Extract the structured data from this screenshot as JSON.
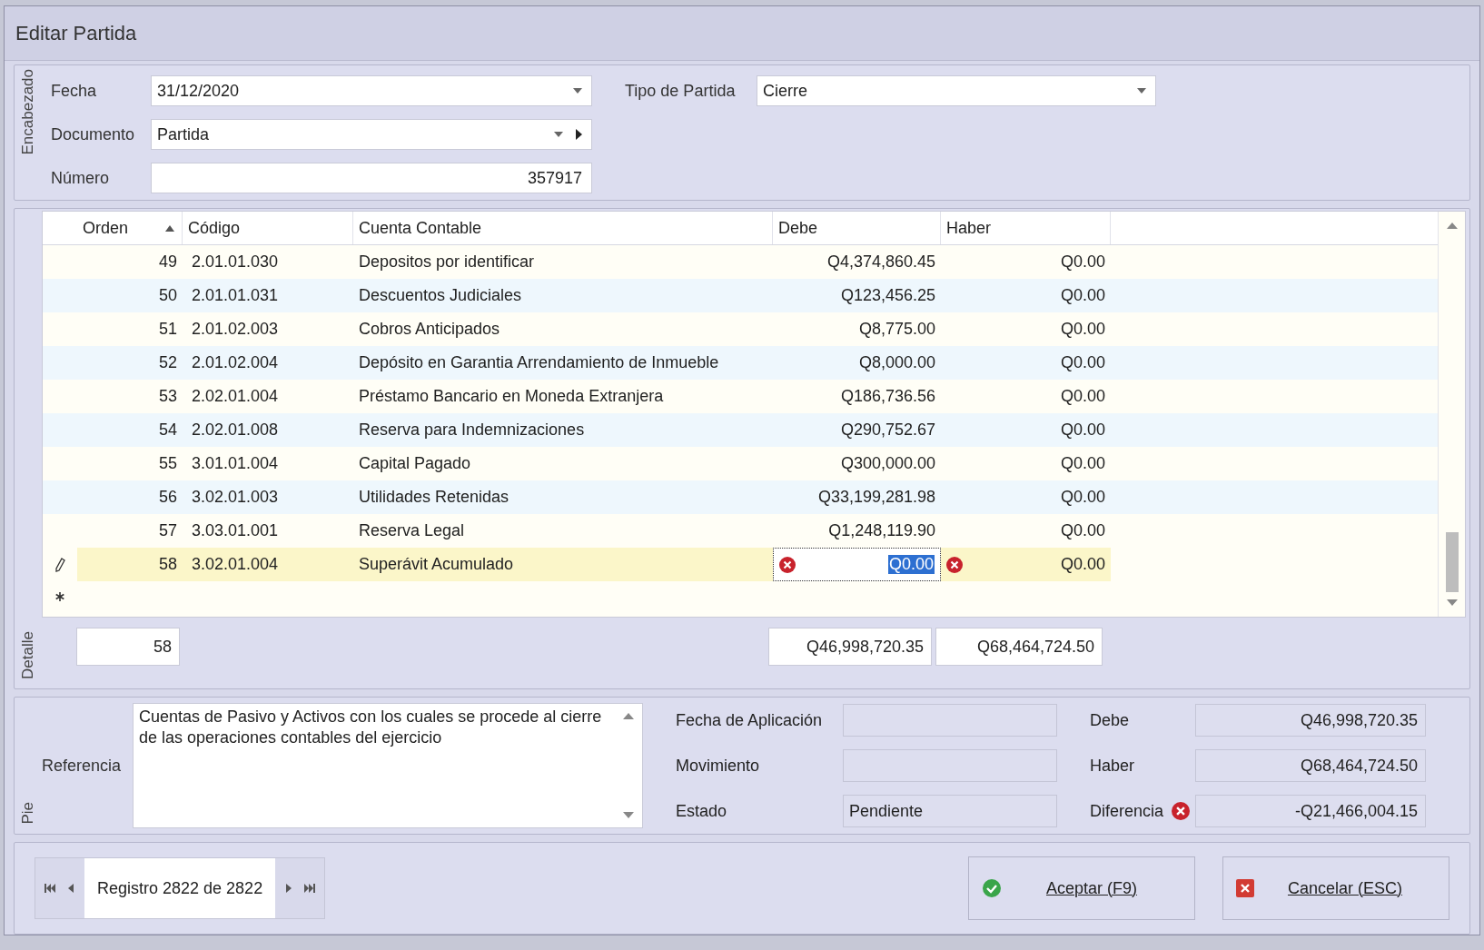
{
  "window": {
    "title": "Editar Partida"
  },
  "encabezado": {
    "group_label": "Encabezado",
    "fecha": {
      "label": "Fecha",
      "value": "31/12/2020"
    },
    "tipo_partida": {
      "label": "Tipo de Partida",
      "value": "Cierre"
    },
    "documento": {
      "label": "Documento",
      "value": "Partida"
    },
    "numero": {
      "label": "Número",
      "value": "357917"
    }
  },
  "detalle": {
    "group_label": "Detalle",
    "columns": [
      {
        "label": "Orden",
        "sorted": true
      },
      {
        "label": "Código",
        "sorted": false
      },
      {
        "label": "Cuenta Contable",
        "sorted": false
      },
      {
        "label": "Debe",
        "sorted": false
      },
      {
        "label": "Haber",
        "sorted": false
      }
    ],
    "rows": [
      {
        "orden": "49",
        "codigo": "2.01.01.030",
        "cuenta": "Depositos por identificar",
        "debe": "Q4,374,860.45",
        "haber": "Q0.00",
        "editing": false,
        "error": false
      },
      {
        "orden": "50",
        "codigo": "2.01.01.031",
        "cuenta": "Descuentos Judiciales",
        "debe": "Q123,456.25",
        "haber": "Q0.00",
        "editing": false,
        "error": false
      },
      {
        "orden": "51",
        "codigo": "2.01.02.003",
        "cuenta": "Cobros Anticipados",
        "debe": "Q8,775.00",
        "haber": "Q0.00",
        "editing": false,
        "error": false
      },
      {
        "orden": "52",
        "codigo": "2.01.02.004",
        "cuenta": "Depósito en Garantia Arrendamiento de Inmueble",
        "debe": "Q8,000.00",
        "haber": "Q0.00",
        "editing": false,
        "error": false
      },
      {
        "orden": "53",
        "codigo": "2.02.01.004",
        "cuenta": "Préstamo Bancario en Moneda Extranjera",
        "debe": "Q186,736.56",
        "haber": "Q0.00",
        "editing": false,
        "error": false
      },
      {
        "orden": "54",
        "codigo": "2.02.01.008",
        "cuenta": "Reserva para Indemnizaciones",
        "debe": "Q290,752.67",
        "haber": "Q0.00",
        "editing": false,
        "error": false
      },
      {
        "orden": "55",
        "codigo": "3.01.01.004",
        "cuenta": "Capital Pagado",
        "debe": "Q300,000.00",
        "haber": "Q0.00",
        "editing": false,
        "error": false
      },
      {
        "orden": "56",
        "codigo": "3.02.01.003",
        "cuenta": "Utilidades Retenidas",
        "debe": "Q33,199,281.98",
        "haber": "Q0.00",
        "editing": false,
        "error": false
      },
      {
        "orden": "57",
        "codigo": "3.03.01.001",
        "cuenta": "Reserva Legal",
        "debe": "Q1,248,119.90",
        "haber": "Q0.00",
        "editing": false,
        "error": false
      },
      {
        "orden": "58",
        "codigo": "3.02.01.004",
        "cuenta": "Superávit Acumulado",
        "debe": "Q0.00",
        "haber": "Q0.00",
        "editing": true,
        "error": true
      }
    ],
    "totals": {
      "orden": "58",
      "debe": "Q46,998,720.35",
      "haber": "Q68,464,724.50"
    }
  },
  "pie": {
    "group_label": "Pie",
    "referencia": {
      "label": "Referencia",
      "value": "Cuentas de Pasivo y Activos con los cuales se procede al cierre de las operaciones contables del ejercicio"
    },
    "fecha_aplicacion": {
      "label": "Fecha de Aplicación"
    },
    "movimiento": {
      "label": "Movimiento"
    },
    "estado": {
      "label": "Estado",
      "value": "Pendiente"
    },
    "debe": {
      "label": "Debe",
      "value": "Q46,998,720.35",
      "error": false
    },
    "haber": {
      "label": "Haber",
      "value": "Q68,464,724.50",
      "error": false
    },
    "diferencia": {
      "label": "Diferencia",
      "value": "-Q21,466,004.15",
      "error": true
    }
  },
  "navigator": {
    "text": "Registro 2822 de 2822"
  },
  "buttons": [
    {
      "kind": "accept",
      "label": "Aceptar (F9)"
    },
    {
      "kind": "cancel",
      "label": "Cancelar (ESC)"
    }
  ]
}
